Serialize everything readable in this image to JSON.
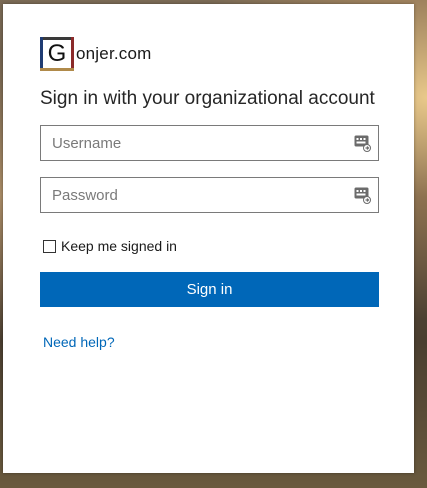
{
  "brand": {
    "logo_letter": "G",
    "name": "onjer.com"
  },
  "form": {
    "heading": "Sign in with your organizational account",
    "username_placeholder": "Username",
    "username_value": "",
    "password_placeholder": "Password",
    "password_value": "",
    "keep_signed_in_label": "Keep me signed in",
    "keep_signed_in_checked": false,
    "signin_label": "Sign in",
    "help_link": "Need help?"
  },
  "icons": {
    "username_field": "credential-key-icon",
    "password_field": "credential-key-icon"
  },
  "colors": {
    "accent": "#0067b8",
    "field_border": "#7a7a7a"
  }
}
